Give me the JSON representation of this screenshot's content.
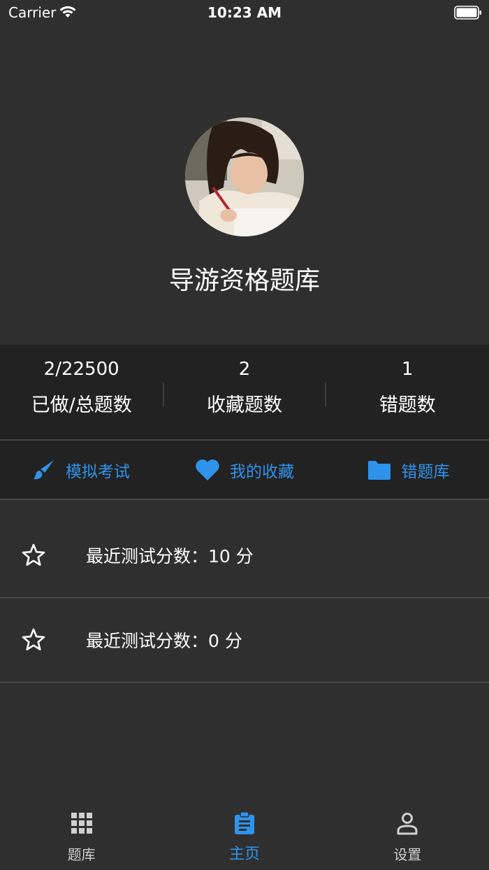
{
  "status_bar": {
    "carrier": "Carrier",
    "time": "10:23 AM"
  },
  "profile": {
    "title": "导游资格题库",
    "avatar": "photo-of-girl-writing"
  },
  "stats": [
    {
      "value": "2/22500",
      "label": "已做/总题数"
    },
    {
      "value": "2",
      "label": "收藏题数"
    },
    {
      "value": "1",
      "label": "错题数"
    }
  ],
  "actions": [
    {
      "label": "模拟考试",
      "icon": "brush-icon"
    },
    {
      "label": "我的收藏",
      "icon": "heart-icon"
    },
    {
      "label": "错题库",
      "icon": "folder-icon"
    }
  ],
  "scores": [
    {
      "text": "最近测试分数：10 分",
      "icon": "star-icon"
    },
    {
      "text": "最近测试分数：0 分",
      "icon": "star-icon"
    }
  ],
  "tabbar": {
    "items": [
      {
        "label": "题库",
        "icon": "grid-icon",
        "active": false
      },
      {
        "label": "主页",
        "icon": "clipboard-icon",
        "active": true
      },
      {
        "label": "设置",
        "icon": "person-icon",
        "active": false
      }
    ]
  },
  "colors": {
    "background": "#2f2f2f",
    "panel": "#222222",
    "accent": "#2f93ec",
    "text": "#ffffff"
  }
}
